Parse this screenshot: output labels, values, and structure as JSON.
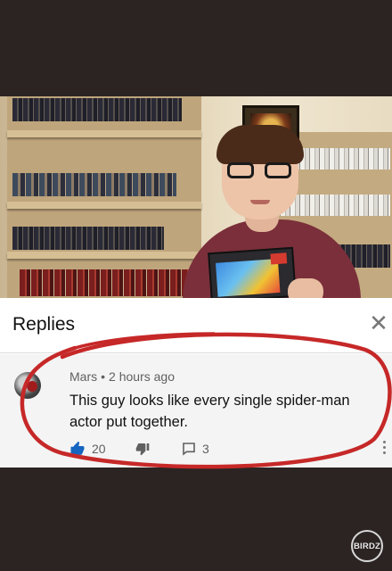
{
  "panel": {
    "title": "Replies",
    "close_icon": "close-icon"
  },
  "comment": {
    "author": "Mars",
    "separator": "•",
    "time": "2 hours ago",
    "text": "This guy looks like every single spider-man actor put together.",
    "likes": "20",
    "replies": "3",
    "like_icon": "thumbs-up-icon",
    "dislike_icon": "thumbs-down-icon",
    "reply_icon": "reply-icon",
    "more_icon": "more-vertical-icon"
  },
  "annotation": {
    "color": "#c62828"
  },
  "watermark": {
    "text": "BIRDZ"
  },
  "colors": {
    "background": "#2b2423",
    "like_blue": "#1565c0",
    "panel_bg": "#f4f4f4"
  }
}
